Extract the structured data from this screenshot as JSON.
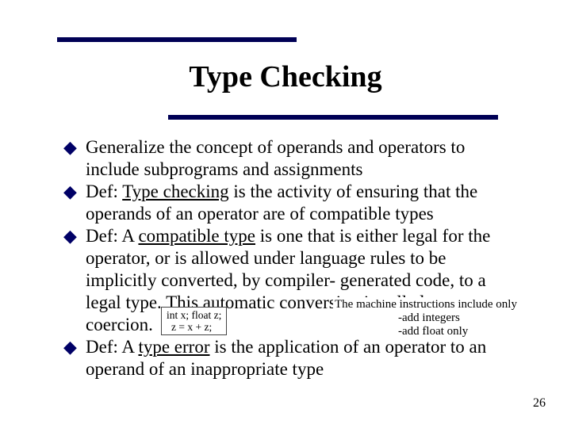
{
  "title": "Type Checking",
  "items": [
    {
      "text": "Generalize the concept of operands and operators to include subprograms and assignments"
    },
    {
      "prefix": "Def: ",
      "underline": "Type checking",
      "rest": " is the activity of ensuring that the operands of an operator are of compatible types"
    },
    {
      "prefix": "Def: A ",
      "underline": "compatible type",
      "rest": " is one that is either legal for the operator, or is allowed under language rules to be implicitly converted, by compiler- generated code, to a legal type. This automatic conversion is called a coercion."
    },
    {
      "prefix": "Def: A ",
      "underline": "type error",
      "rest": " is the application of an operator to an operand of an inappropriate type"
    }
  ],
  "code": {
    "line1": "int x; float z;",
    "line2": "z = x + z;"
  },
  "note": {
    "line1": "The machine instructions include only",
    "line2": "-add integers",
    "line3": "-add float only"
  },
  "page": "26"
}
